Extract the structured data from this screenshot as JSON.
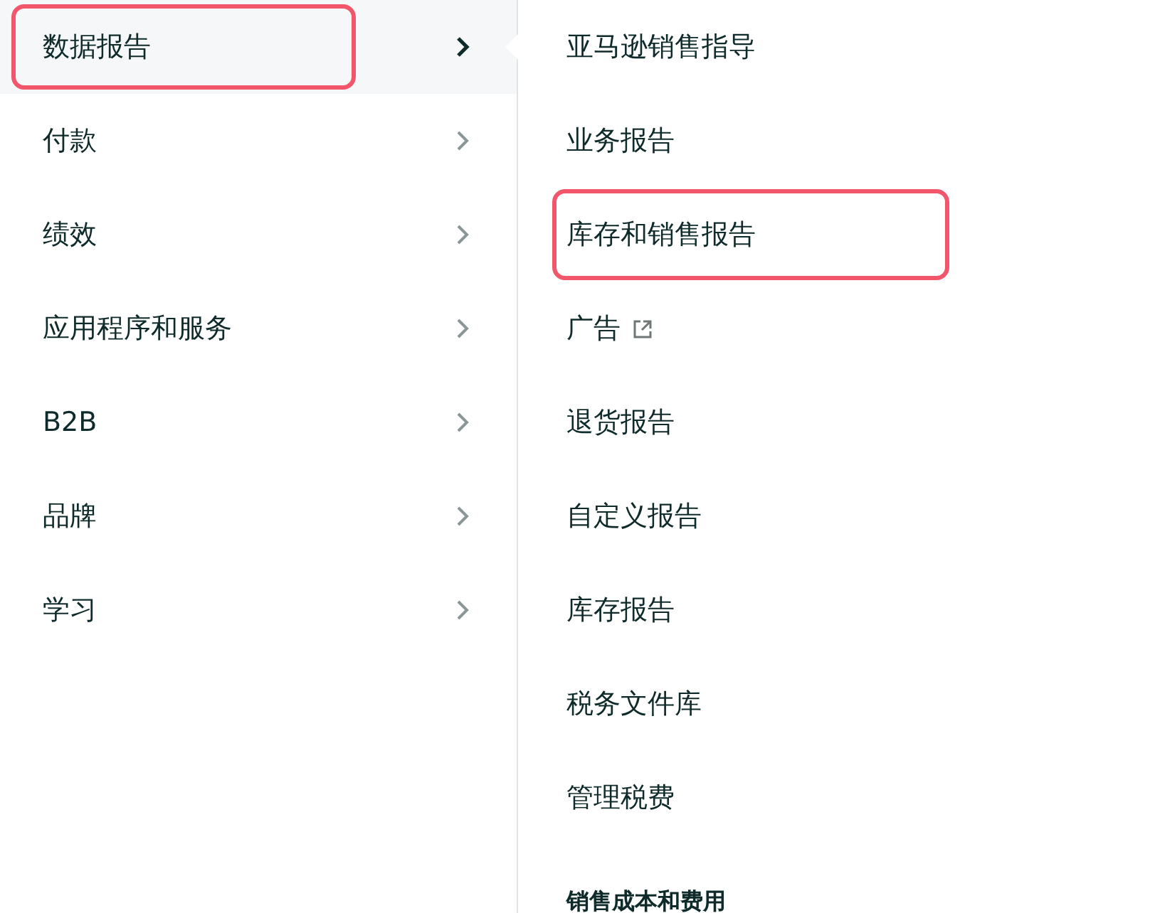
{
  "menu": {
    "items": [
      {
        "label": "数据报告",
        "selected": true,
        "highlighted": true
      },
      {
        "label": "付款",
        "selected": false,
        "highlighted": false
      },
      {
        "label": "绩效",
        "selected": false,
        "highlighted": false
      },
      {
        "label": "应用程序和服务",
        "selected": false,
        "highlighted": false
      },
      {
        "label": "B2B",
        "selected": false,
        "highlighted": false
      },
      {
        "label": "品牌",
        "selected": false,
        "highlighted": false
      },
      {
        "label": "学习",
        "selected": false,
        "highlighted": false
      }
    ]
  },
  "submenu": {
    "items": [
      {
        "kind": "link",
        "label": "亚马逊销售指导",
        "highlighted": false
      },
      {
        "kind": "link",
        "label": "业务报告",
        "highlighted": false
      },
      {
        "kind": "link",
        "label": "库存和销售报告",
        "highlighted": true
      },
      {
        "kind": "external",
        "label": "广告",
        "highlighted": false
      },
      {
        "kind": "link",
        "label": "退货报告",
        "highlighted": false
      },
      {
        "kind": "link",
        "label": "自定义报告",
        "highlighted": false
      },
      {
        "kind": "link",
        "label": "库存报告",
        "highlighted": false
      },
      {
        "kind": "link",
        "label": "税务文件库",
        "highlighted": false
      },
      {
        "kind": "link",
        "label": "管理税费",
        "highlighted": false
      },
      {
        "kind": "heading",
        "label": "销售成本和费用",
        "highlighted": false
      }
    ]
  }
}
